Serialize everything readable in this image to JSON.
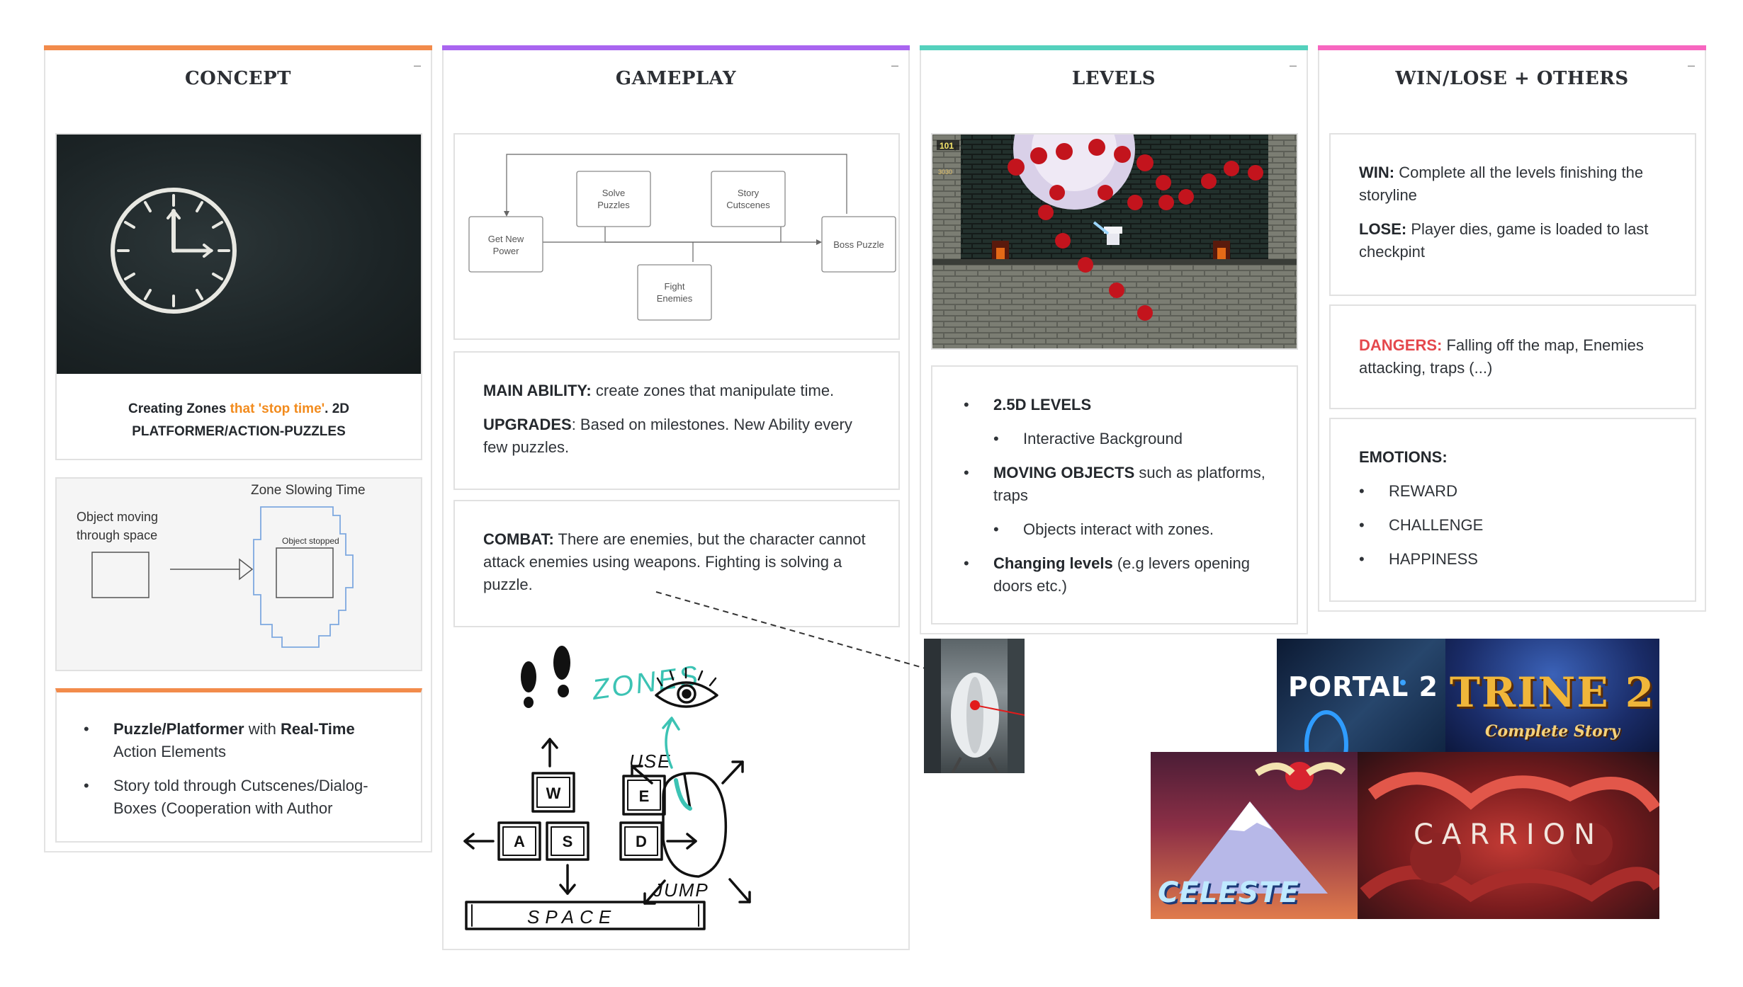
{
  "colors": {
    "concept": "#f28b4b",
    "gameplay": "#a965f0",
    "levels": "#54d1bd",
    "winlose": "#f766c0",
    "orange_text": "#f28b1d",
    "danger": "#e5484d",
    "zones_ink": "#3cc3b4"
  },
  "concept": {
    "title": "CONCEPT",
    "minimize": "–",
    "caption_a": "Creating Zones ",
    "caption_b": "that 'stop time'",
    "caption_c": ". 2D PLATFORMER/ACTION-PUZZLES",
    "zone_diagram": {
      "title": "Zone Slowing Time",
      "left_label_1": "Object moving",
      "left_label_2": "through space",
      "stopped_label": "Object stopped"
    },
    "bullets": [
      {
        "bold": "Puzzle/Platformer",
        "mid": " with ",
        "bold2": "Real-Time",
        "rest": " Action Elements"
      },
      {
        "text": "Story told through Cutscenes/Dialog-Boxes (Cooperation with Author"
      }
    ]
  },
  "gameplay": {
    "title": "GAMEPLAY",
    "minimize": "–",
    "flow": {
      "get_new_power": [
        "Get New",
        "Power"
      ],
      "solve_puzzles": [
        "Solve",
        "Puzzles"
      ],
      "story_cutscenes": [
        "Story",
        "Cutscenes"
      ],
      "fight_enemies": [
        "Fight",
        "Enemies"
      ],
      "boss_puzzle": "Boss Puzzle"
    },
    "main_ability_label": "MAIN ABILITY:",
    "main_ability_text": " create zones that manipulate time.",
    "upgrades_label": "UPGRADES",
    "upgrades_text": ": Based on milestones. New Ability every few puzzles.",
    "combat_label": "COMBAT:",
    "combat_text": " There are enemies, but the character cannot attack enemies using weapons. Fighting is solving a puzzle.",
    "sketch": {
      "zones": "ZONES",
      "use": "USE",
      "jump": "JUMP",
      "space": "SPACE",
      "keys": [
        "W",
        "E",
        "A",
        "S",
        "D"
      ]
    }
  },
  "levels": {
    "title": "LEVELS",
    "minimize": "–",
    "hud_a": "101",
    "hud_b": "3030",
    "items": [
      {
        "bold": "2.5D LEVELS",
        "rest": ""
      },
      {
        "sub": "Interactive Background"
      },
      {
        "bold": "MOVING OBJECTS",
        "rest": " such as platforms, traps"
      },
      {
        "sub": "Objects interact with zones."
      },
      {
        "bold": "Changing levels",
        "rest": " (e.g levers opening doors etc.)"
      }
    ]
  },
  "winlose": {
    "title": "WIN/LOSE + OTHERS",
    "minimize": "–",
    "win_label": "WIN:",
    "win_text": " Complete all the levels finishing the storyline",
    "lose_label": "LOSE:",
    "lose_text": " Player dies, game is loaded to last checkpint",
    "dangers_label": "DANGERS:",
    "dangers_text": " Falling off the map, Enemies attacking, traps (...)",
    "emotions_label": "EMOTIONS:",
    "emotions": [
      "REWARD",
      "CHALLENGE",
      "HAPPINESS"
    ]
  },
  "references": {
    "portal": "PORTAL 2",
    "trine": "TRINE 2",
    "trine_sub": "Complete Story",
    "celeste": "CELESTE",
    "carrion": "CARRION"
  }
}
